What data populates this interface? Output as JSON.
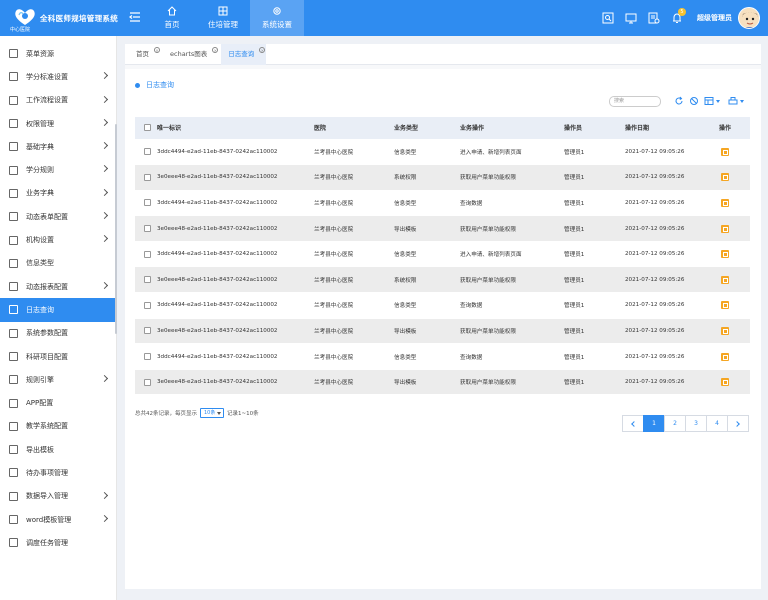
{
  "header": {
    "title": "全科医师规培管理系统",
    "subtitle": "中心医院",
    "nav": [
      {
        "label": "首页",
        "icon": "home-icon"
      },
      {
        "label": "住培管理",
        "icon": "manage-icon"
      },
      {
        "label": "系统设置",
        "icon": "gear-icon"
      }
    ],
    "notification_count": "5",
    "user": "超级管理员"
  },
  "sidebar": {
    "items": [
      {
        "label": "菜单资源",
        "sub": false
      },
      {
        "label": "学分标准设置",
        "sub": true
      },
      {
        "label": "工作流程设置",
        "sub": true
      },
      {
        "label": "权限管理",
        "sub": true
      },
      {
        "label": "基础字典",
        "sub": true
      },
      {
        "label": "学分规则",
        "sub": true
      },
      {
        "label": "业务字典",
        "sub": true
      },
      {
        "label": "动态表单配置",
        "sub": true
      },
      {
        "label": "机构设置",
        "sub": true
      },
      {
        "label": "信息类型",
        "sub": false
      },
      {
        "label": "动态报表配置",
        "sub": true
      },
      {
        "label": "日志查询",
        "sub": false,
        "active": true
      },
      {
        "label": "系统参数配置",
        "sub": false
      },
      {
        "label": "科研项目配置",
        "sub": false
      },
      {
        "label": "规则引擎",
        "sub": true
      },
      {
        "label": "APP配置",
        "sub": false
      },
      {
        "label": "教学系统配置",
        "sub": false
      },
      {
        "label": "导出模板",
        "sub": false
      },
      {
        "label": "待办事项管理",
        "sub": false
      },
      {
        "label": "数据导入管理",
        "sub": true
      },
      {
        "label": "word模板管理",
        "sub": true
      },
      {
        "label": "调度任务管理",
        "sub": false
      }
    ]
  },
  "tabs": [
    {
      "label": "首页"
    },
    {
      "label": "echarts图表"
    },
    {
      "label": "日志查询",
      "active": true
    }
  ],
  "panel": {
    "title": "日志查询",
    "search_placeholder": "搜索"
  },
  "table": {
    "headers": [
      "唯一标识",
      "医院",
      "业务类型",
      "业务操作",
      "操作员",
      "操作日期",
      "操作"
    ],
    "rows": [
      [
        "3ddc4494-e2ad-11eb-8437-0242ac110002",
        "兰考县中心医院",
        "信息类型",
        "进入申请、新增列表页面",
        "管理员1",
        "2021-07-12 09:05:26"
      ],
      [
        "3e0eee48-e2ad-11eb-8437-0242ac110002",
        "兰考县中心医院",
        "系统权限",
        "获取用户菜单功能权限",
        "管理员1",
        "2021-07-12 09:05:26"
      ],
      [
        "3ddc4494-e2ad-11eb-8437-0242ac110002",
        "兰考县中心医院",
        "信息类型",
        "查询数据",
        "管理员1",
        "2021-07-12 09:05:26"
      ],
      [
        "3e0eee48-e2ad-11eb-8437-0242ac110002",
        "兰考县中心医院",
        "导出模板",
        "获取用户菜单功能权限",
        "管理员1",
        "2021-07-12 09:05:26"
      ],
      [
        "3ddc4494-e2ad-11eb-8437-0242ac110002",
        "兰考县中心医院",
        "信息类型",
        "进入申请、新增列表页面",
        "管理员1",
        "2021-07-12 09:05:26"
      ],
      [
        "3e0eee48-e2ad-11eb-8437-0242ac110002",
        "兰考县中心医院",
        "系统权限",
        "获取用户菜单功能权限",
        "管理员1",
        "2021-07-12 09:05:26"
      ],
      [
        "3ddc4494-e2ad-11eb-8437-0242ac110002",
        "兰考县中心医院",
        "信息类型",
        "查询数据",
        "管理员1",
        "2021-07-12 09:05:26"
      ],
      [
        "3e0eee48-e2ad-11eb-8437-0242ac110002",
        "兰考县中心医院",
        "导出模板",
        "获取用户菜单功能权限",
        "管理员1",
        "2021-07-12 09:05:26"
      ],
      [
        "3ddc4494-e2ad-11eb-8437-0242ac110002",
        "兰考县中心医院",
        "信息类型",
        "查询数据",
        "管理员1",
        "2021-07-12 09:05:26"
      ],
      [
        "3e0eee48-e2ad-11eb-8437-0242ac110002",
        "兰考县中心医院",
        "导出模板",
        "获取用户菜单功能权限",
        "管理员1",
        "2021-07-12 09:05:26"
      ]
    ]
  },
  "pagination": {
    "summary_prefix": "总共42条记录，每页显示",
    "page_size": "10条",
    "summary_suffix": "记录1~10条",
    "pages": [
      "1",
      "2",
      "3",
      "4"
    ],
    "current": "1"
  },
  "colors": {
    "accent": "#2f8cf0",
    "action": "#f5a623"
  }
}
